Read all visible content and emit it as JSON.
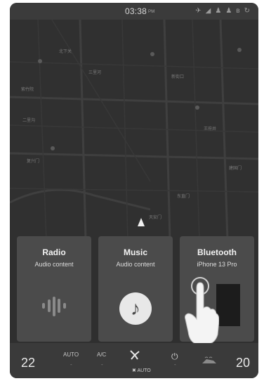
{
  "status": {
    "time": "03:38",
    "ampm": "PM",
    "icons": [
      "plane-icon",
      "signal-icon",
      "user-icon",
      "user-icon",
      "bluetooth-icon",
      "refresh-icon"
    ]
  },
  "map": {
    "labels": [
      "紫竹院",
      "北下关",
      "二里沟",
      "新街口",
      "复兴门",
      "天安门",
      "王府井",
      "建国门",
      "三里河",
      "东直门"
    ]
  },
  "cards": [
    {
      "title": "Radio",
      "subtitle": "Audio content",
      "icon": "sound-wave-icon"
    },
    {
      "title": "Music",
      "subtitle": "Audio content",
      "icon": "music-note-icon"
    },
    {
      "title": "Bluetooth",
      "subtitle": "iPhone 13 Pro",
      "icon": "bluetooth-device-icon"
    }
  ],
  "climate": {
    "left_temp": "22",
    "right_temp": "20",
    "auto_label": "AUTO",
    "ac_label": "A/C",
    "fan_label": "AUTO",
    "power_glyph": "⏻"
  },
  "colors": {
    "screen_bg": "#2f2f2f",
    "card_bg": "#4b4b4b",
    "text": "#f2f2f2"
  }
}
